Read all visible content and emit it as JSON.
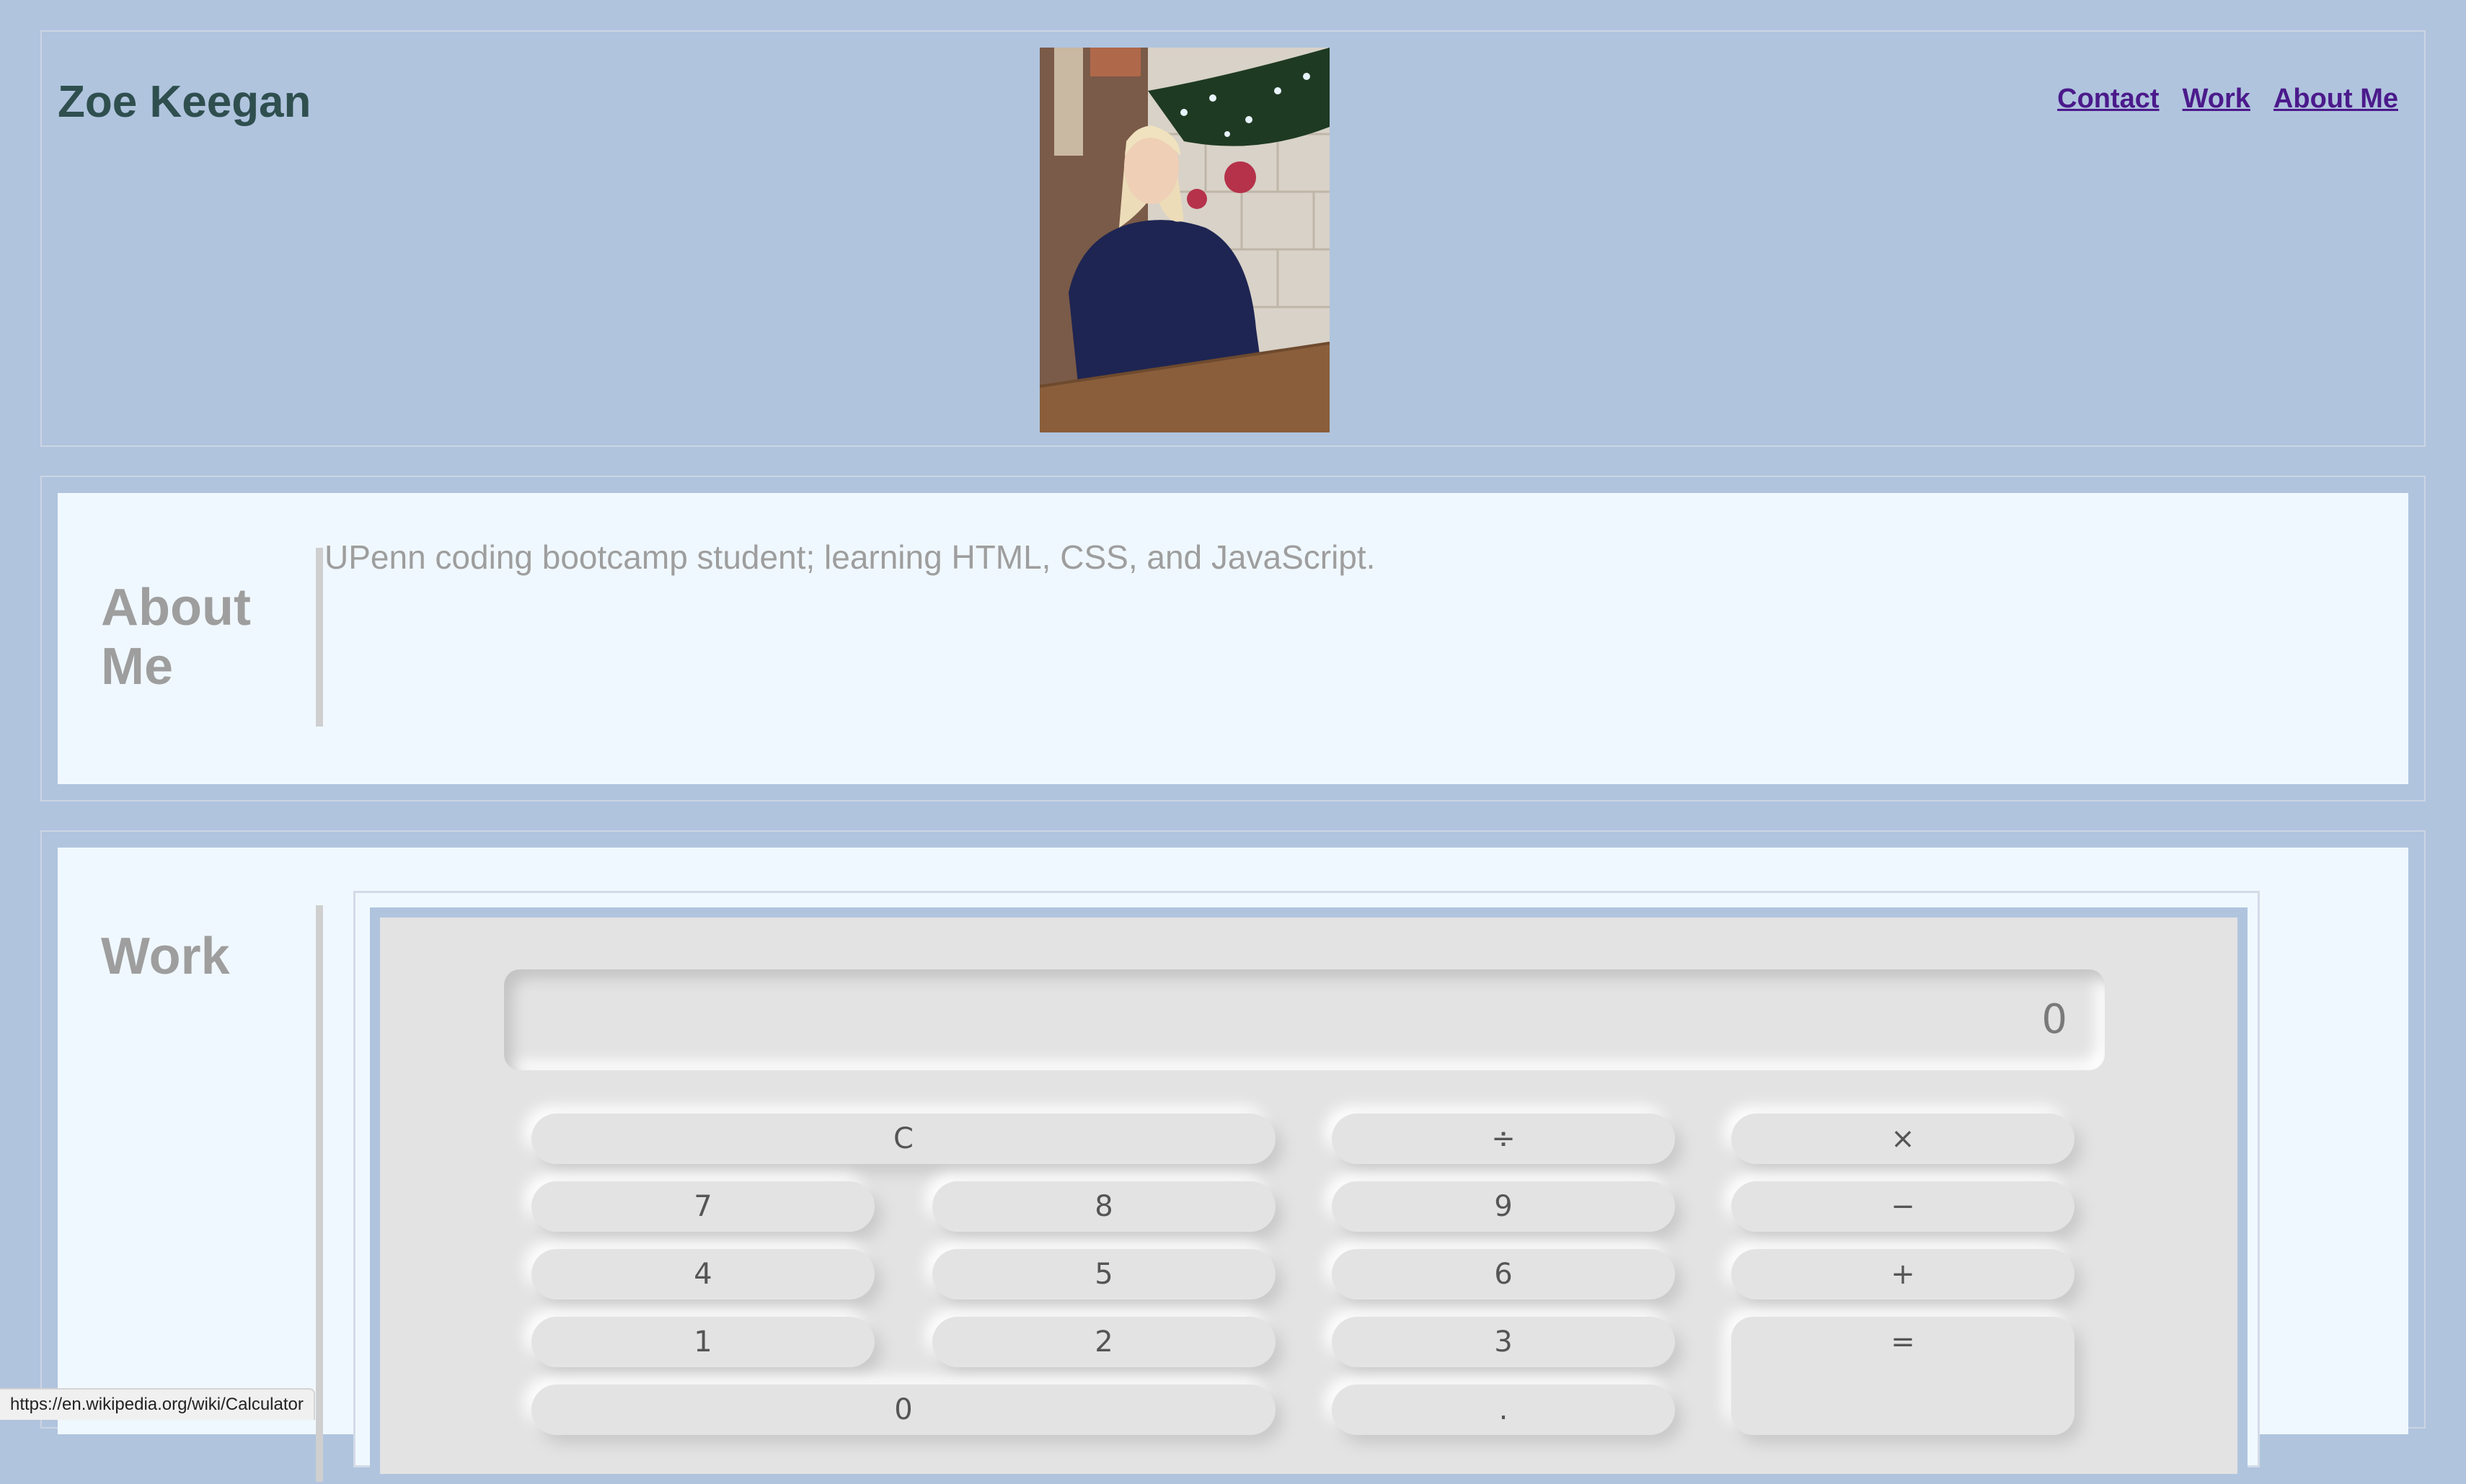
{
  "header": {
    "name": "Zoe Keegan",
    "nav": [
      {
        "label": "Contact"
      },
      {
        "label": "Work"
      },
      {
        "label": "About Me"
      }
    ]
  },
  "about": {
    "title_line1": "About",
    "title_line2": "Me",
    "text": "UPenn coding bootcamp student; learning HTML, CSS, and JavaScript."
  },
  "work": {
    "title": "Work",
    "calculator": {
      "display": "0",
      "buttons": {
        "clear": "C",
        "divide": "÷",
        "multiply": "×",
        "seven": "7",
        "eight": "8",
        "nine": "9",
        "minus": "−",
        "four": "4",
        "five": "5",
        "six": "6",
        "plus": "+",
        "one": "1",
        "two": "2",
        "three": "3",
        "equals": "=",
        "zero": "0",
        "decimal": "."
      }
    }
  },
  "status_bar": {
    "url": "https://en.wikipedia.org/wiki/Calculator"
  },
  "colors": {
    "background": "#b0c4de",
    "card": "#f0f8ff",
    "nav_link": "#4b1a8b",
    "name": "#2f4f4f",
    "section_title": "#9e9e9e"
  }
}
